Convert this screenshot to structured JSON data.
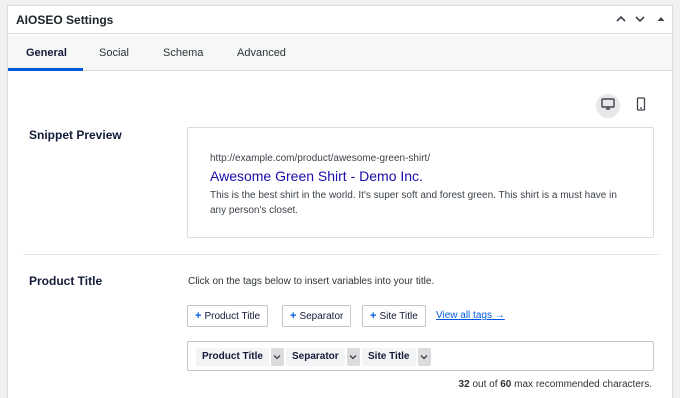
{
  "panel": {
    "title": "AIOSEO Settings",
    "controls": [
      "chevron-up-icon",
      "chevron-down-icon",
      "triangle-up-icon"
    ]
  },
  "tabs": [
    {
      "label": "General",
      "active": true
    },
    {
      "label": "Social",
      "active": false
    },
    {
      "label": "Schema",
      "active": false
    },
    {
      "label": "Advanced",
      "active": false
    }
  ],
  "preview_devices": {
    "selected": "desktop",
    "items": [
      "desktop-icon",
      "mobile-icon"
    ]
  },
  "snippet": {
    "label": "Snippet Preview",
    "url": "http://example.com/product/awesome-green-shirt/",
    "title": "Awesome Green Shirt - Demo Inc.",
    "description": "This is the best shirt in the world. It's super soft and forest green. This shirt is a must have in any person's closet."
  },
  "product_title": {
    "label": "Product Title",
    "helper": "Click on the tags below to insert variables into your title.",
    "tag_buttons": [
      "Product Title",
      "Separator",
      "Site Title"
    ],
    "view_all": "View all tags →",
    "tokens": [
      "Product Title",
      "Separator",
      "Site Title"
    ],
    "count": "32",
    "count_mid": " out of ",
    "max": "60",
    "count_suffix": " max recommended characters."
  },
  "colors": {
    "accent": "#005ae0",
    "snippet_title": "#1a0dab"
  }
}
